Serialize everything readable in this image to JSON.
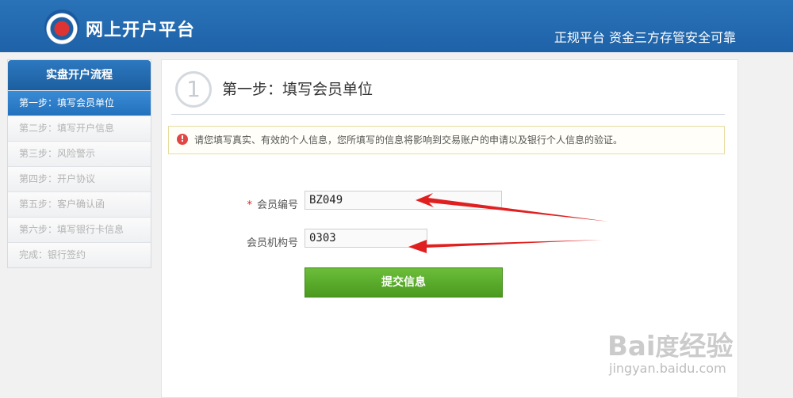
{
  "header": {
    "title": "网上开户平台",
    "tagline": "正规平台 资金三方存管安全可靠"
  },
  "sidebar": {
    "title": "实盘开户流程",
    "items": [
      {
        "label": "第一步：填写会员单位",
        "active": true
      },
      {
        "label": "第二步：填写开户信息",
        "active": false
      },
      {
        "label": "第三步：风险警示",
        "active": false
      },
      {
        "label": "第四步：开户协议",
        "active": false
      },
      {
        "label": "第五步：客户确认函",
        "active": false
      },
      {
        "label": "第六步：填写银行卡信息",
        "active": false
      },
      {
        "label": "完成：银行签约",
        "active": false
      }
    ]
  },
  "main": {
    "step_number": "1",
    "step_title": "第一步：填写会员单位",
    "notice": "请您填写真实、有效的个人信息，您所填写的信息将影响到交易账户的申请以及银行个人信息的验证。",
    "form": {
      "member_no_label": "会员编号",
      "member_no_value": "BZ049",
      "member_org_label": "会员机构号",
      "member_org_value": "0303",
      "submit_label": "提交信息"
    }
  },
  "watermark": {
    "brand": "Bai度经验",
    "url": "jingyan.baidu.com"
  },
  "colors": {
    "header_blue": "#1e62a8",
    "submit_green": "#5aab2b",
    "arrow_red": "#e02020",
    "required_star": "#dd2222"
  }
}
